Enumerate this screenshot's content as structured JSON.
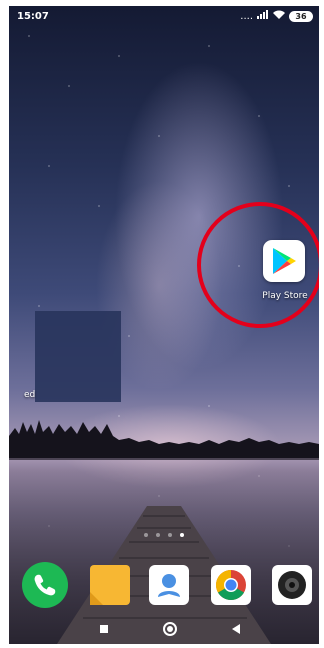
{
  "status_bar": {
    "time": "15:07",
    "signal_dots": "....",
    "battery": "36"
  },
  "home": {
    "apps": [
      {
        "label": "Play Store",
        "icon": "play-store-icon"
      }
    ],
    "widget_label": "ed",
    "page_indicator": {
      "count": 4,
      "active_index": 3
    }
  },
  "dock": {
    "apps": [
      {
        "icon": "phone-icon",
        "color": "#1db954"
      },
      {
        "icon": "notes-icon",
        "color": "#f7b733"
      },
      {
        "icon": "contacts-icon",
        "color": "#4a90e2"
      },
      {
        "icon": "chrome-icon",
        "color": "#db4437"
      },
      {
        "icon": "camera-icon",
        "color": "#222222"
      }
    ]
  },
  "nav_bar": {
    "buttons": [
      "recents",
      "home",
      "back"
    ]
  },
  "colors": {
    "highlight": "#e3001b"
  }
}
